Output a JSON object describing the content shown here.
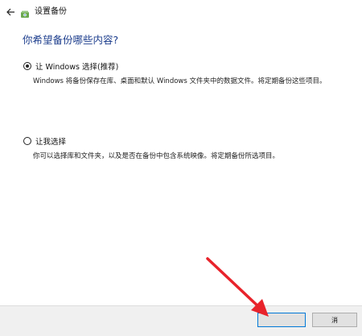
{
  "window": {
    "title": "设置备份"
  },
  "heading": "你希望备份哪些内容?",
  "options": [
    {
      "label": "让 Windows 选择(推荐)",
      "description": "Windows 将备份保存在库、桌面和默认 Windows 文件夹中的数据文件。将定期备份这些项目。",
      "selected": true
    },
    {
      "label": "让我选择",
      "description": "你可以选择库和文件夹，以及是否在备份中包含系统映像。将定期备份所选项目。",
      "selected": false
    }
  ],
  "footer": {
    "cancel_label": "消"
  },
  "icons": {
    "back": "back-arrow-icon",
    "app": "backup-app-icon",
    "annotation": "red-arrow-annotation"
  },
  "colors": {
    "heading": "#1b3c8c",
    "annotation_arrow": "#e8232b",
    "primary_button_border": "#0078d7"
  }
}
